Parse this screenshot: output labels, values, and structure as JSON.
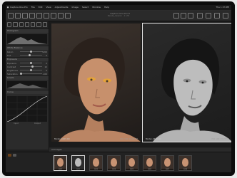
{
  "app": {
    "menubar": {
      "items": [
        "Capture One Pro",
        "File",
        "Edit",
        "View",
        "Adjustments",
        "Image",
        "Select",
        "Window",
        "Help"
      ],
      "right_text": "Thu 1:33 PM"
    },
    "window_title": "Capture One Pro 8",
    "window_subtitle": "Beauty_Session - 2 of 8"
  },
  "left_panel": {
    "sections": [
      {
        "title": "Histogram"
      },
      {
        "title": "White Balance"
      },
      {
        "title": "Exposure"
      },
      {
        "title": "Levels"
      },
      {
        "title": "Curve"
      }
    ],
    "sliders": [
      {
        "label": "Kelvin",
        "value": "5200",
        "pos": 0.5
      },
      {
        "label": "Tint",
        "value": "0",
        "pos": 0.45
      },
      {
        "label": "Exposure",
        "value": "0",
        "pos": 0.5
      },
      {
        "label": "Contrast",
        "value": "12",
        "pos": 0.58
      },
      {
        "label": "Brightness",
        "value": "0",
        "pos": 0.5
      },
      {
        "label": "Saturation",
        "value": "-100",
        "pos": 0.05
      }
    ],
    "curve_footer": [
      "Input",
      "Output"
    ]
  },
  "viewer": {
    "images": [
      {
        "caption": "Model_0423.IIQ",
        "meta": "ISO 100  1/125  f/8",
        "mode": "color",
        "selected": false
      },
      {
        "caption": "Model_0423.IIQ",
        "meta": "ISO 100  1/125  f/8",
        "mode": "bw",
        "selected": true
      }
    ]
  },
  "filmstrip": {
    "label": "All Images",
    "thumbs": [
      {
        "name": "0421",
        "mode": "color",
        "selected": true
      },
      {
        "name": "0422",
        "mode": "bw",
        "selected": true
      },
      {
        "name": "0423",
        "mode": "color",
        "selected": false
      },
      {
        "name": "0424",
        "mode": "color",
        "selected": false
      },
      {
        "name": "0425",
        "mode": "color",
        "selected": false
      },
      {
        "name": "0426",
        "mode": "color",
        "selected": false
      },
      {
        "name": "0427",
        "mode": "color",
        "selected": false
      },
      {
        "name": "0428",
        "mode": "color",
        "selected": false
      }
    ]
  },
  "colors": {
    "accent": "#e08a1a",
    "skin": "#c89373",
    "bw_skin": "#bdbdbd"
  }
}
